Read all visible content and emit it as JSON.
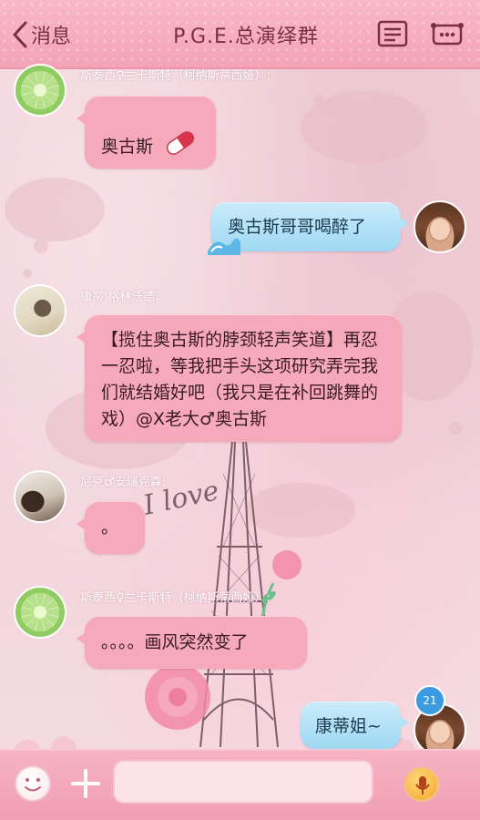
{
  "header": {
    "back_label": "消息",
    "title": "P.G.E.总演绎群"
  },
  "messages": [
    {
      "sender": "斯泰西♀兰卡斯特（柯纳斯蒂西娅）:",
      "text": "奥古斯",
      "avatar": "lime-avatar",
      "side": "left"
    },
    {
      "sender": "",
      "text": "奥古斯哥哥喝醉了",
      "avatar": "girl-avatar",
      "side": "right"
    },
    {
      "sender": "康蒂 格林沃德:",
      "text": "【揽住奥古斯的脖颈轻声笑道】再忍一忍啦，等我把手头这项研究弄完我们就结婚好吧（我只是在补回跳舞的戏）@X老大♂奥古斯",
      "avatar": "doll-avatar",
      "side": "left"
    },
    {
      "sender": "尼克♂安瑞克森:",
      "text": "。",
      "avatar": "piano-avatar",
      "side": "left"
    },
    {
      "sender": "斯泰西♀兰卡斯特（柯纳斯蒂西娅）:",
      "text": "。。。。画风突然变了",
      "avatar": "lime-avatar",
      "side": "left"
    },
    {
      "sender": "",
      "text": "康蒂姐~",
      "avatar": "girl-avatar",
      "side": "right"
    }
  ],
  "unread_badge": "21",
  "wallpaper_text": "I love",
  "input": {
    "placeholder": ""
  },
  "colors": {
    "header": "#f4a3b6",
    "bubble_left": "#f6a9bb",
    "bubble_right": "#9fd8f3",
    "badge": "#3c9be0"
  },
  "icons": [
    "chevron-left-icon",
    "chat-menu-icon",
    "group-more-icon",
    "emoji-icon",
    "plus-icon",
    "microphone-icon",
    "pill-icon"
  ]
}
